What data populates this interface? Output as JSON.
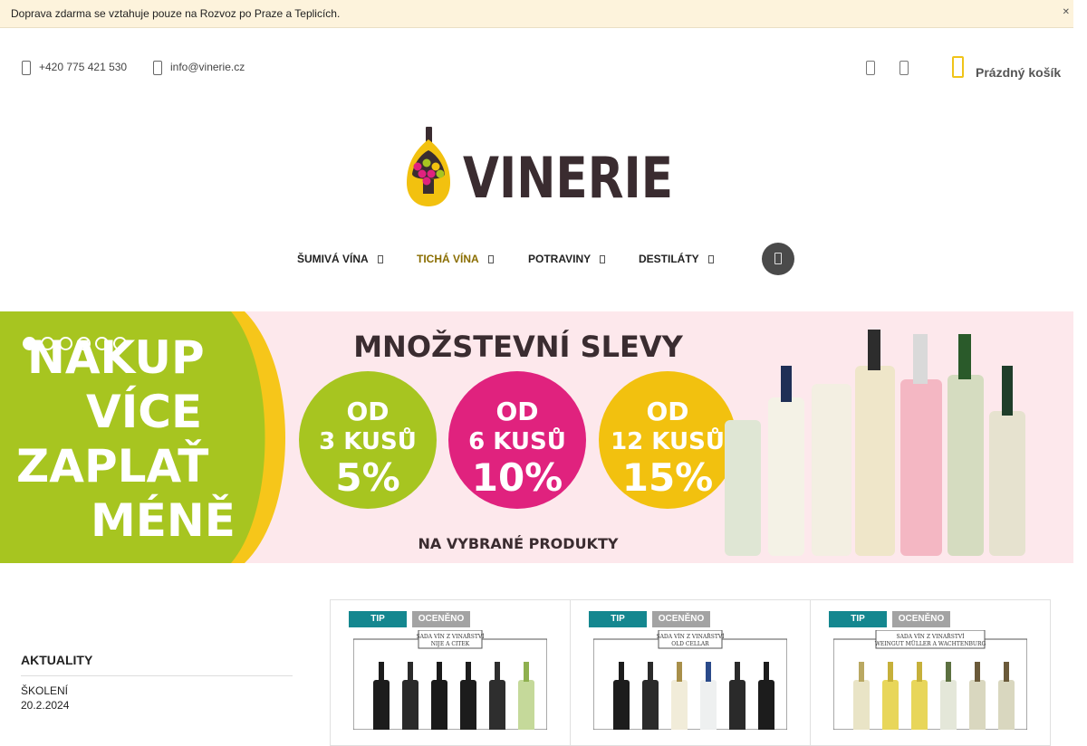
{
  "notice": {
    "text": "Doprava zdarma se vztahuje pouze na Rozvoz po Praze a Teplicích.",
    "close_icon": "close-icon"
  },
  "contact": {
    "phone": "+420 775 421 530",
    "email": "info@vinerie.cz"
  },
  "cart": {
    "label": "Prázdný košík",
    "accent": "#f0c419"
  },
  "logo": {
    "text": "VINERIE"
  },
  "nav": [
    {
      "label": "ŠUMIVÁ VÍNA"
    },
    {
      "label": "TICHÁ VÍNA"
    },
    {
      "label": "POTRAVINY"
    },
    {
      "label": "DESTILÁTY"
    }
  ],
  "banner": {
    "left_text": [
      "NAKUP",
      "VÍCE",
      "ZAPLAŤ",
      "MÉNĚ"
    ],
    "title": "MNOŽSTEVNÍ SLEVY",
    "badges": [
      {
        "line1": "OD",
        "line2": "3 KUSŮ",
        "line3": "5%",
        "color": "#a7c520"
      },
      {
        "line1": "OD",
        "line2": "6 KUSŮ",
        "line3": "10%",
        "color": "#e0227e"
      },
      {
        "line1": "OD",
        "line2": "12 KUSŮ",
        "line3": "15%",
        "color": "#f2c10f"
      }
    ],
    "footer": "NA VYBRANÉ PRODUKTY",
    "slides": 6,
    "active_slide": 1
  },
  "sidebar": {
    "title": "AKTUALITY",
    "items": [
      {
        "title": "ŠKOLENÍ",
        "date": "20.2.2024"
      }
    ]
  },
  "products": [
    {
      "tip": "TIP",
      "award": "OCENĚNO",
      "caption_lines": [
        "SADA VÍN Z VINAŘSTVÍ",
        "NIJE A CITEK"
      ]
    },
    {
      "tip": "TIP",
      "award": "OCENĚNO",
      "caption_lines": [
        "SADA VÍN Z VINAŘSTVÍ",
        "OLD CELLAR"
      ]
    },
    {
      "tip": "TIP",
      "award": "OCENĚNO",
      "caption_lines": [
        "SADA VÍN Z VINAŘSTVÍ",
        "WEINGUT MÜLLER A WACHTENBURG"
      ]
    }
  ]
}
